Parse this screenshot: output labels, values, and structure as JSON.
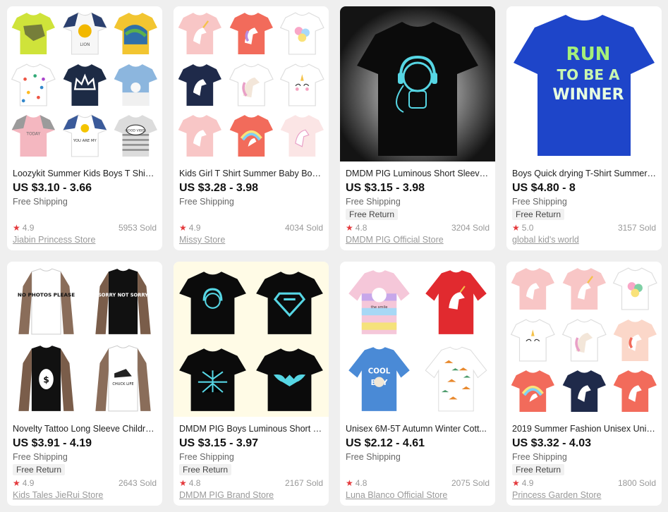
{
  "products": [
    {
      "title": "Loozykit Summer Kids Boys T Shirt...",
      "price": "US $3.10 - 3.66",
      "shipping": "Free Shipping",
      "free_return": "",
      "rating": "4.9",
      "sold": "5953 Sold",
      "store": "Jiabin Princess Store",
      "thumb_text": [
        "LION",
        "YOU ARE MY",
        "GOOD VIBES",
        "TODAY"
      ]
    },
    {
      "title": "Kids Girl T Shirt Summer Baby Boy ...",
      "price": "US $3.28 - 3.98",
      "shipping": "Free Shipping",
      "free_return": "",
      "rating": "4.9",
      "sold": "4034 Sold",
      "store": "Missy Store"
    },
    {
      "title": "DMDM PIG Luminous Short Sleeve...",
      "price": "US $3.15 - 3.98",
      "shipping": "Free Shipping",
      "free_return": "Free Return",
      "rating": "4.8",
      "sold": "3204 Sold",
      "store": "DMDM PIG Official Store"
    },
    {
      "title": "Boys Quick drying T-Shirt Summer ...",
      "price": "US $4.80 - 8",
      "shipping": "Free Shipping",
      "free_return": "Free Return",
      "rating": "5.0",
      "sold": "3157 Sold",
      "store": "global kid's world",
      "thumb_text": [
        "RUN",
        "TO BE A",
        "WINNER"
      ]
    },
    {
      "title": "Novelty Tattoo Long Sleeve Childre...",
      "price": "US $3.91 - 4.19",
      "shipping": "Free Shipping",
      "free_return": "Free Return",
      "rating": "4.9",
      "sold": "2643 Sold",
      "store": "Kids Tales JieRui Store",
      "thumb_text": [
        "NO PHOTOS PLEASE",
        "SORRY NOT SORRY",
        "$",
        "CHUCK LIFE"
      ]
    },
    {
      "title": "DMDM PIG Boys Luminous Short S...",
      "price": "US $3.15 - 3.97",
      "shipping": "Free Shipping",
      "free_return": "Free Return",
      "rating": "4.8",
      "sold": "2167 Sold",
      "store": "DMDM PIG Brand Store"
    },
    {
      "title": "Unisex 6M-5T Autumn Winter Cott...",
      "price": "US $2.12 - 4.61",
      "shipping": "Free Shipping",
      "free_return": "",
      "rating": "4.8",
      "sold": "2075 Sold",
      "store": "Luna Blanco Official Store",
      "thumb_text": [
        "the smile",
        "COOL",
        "BOY"
      ]
    },
    {
      "title": "2019 Summer Fashion Unisex Unic...",
      "price": "US $3.32 - 4.03",
      "shipping": "Free Shipping",
      "free_return": "Free Return",
      "rating": "4.9",
      "sold": "1800 Sold",
      "store": "Princess Garden Store"
    }
  ],
  "colors": {
    "star": "#e4393c",
    "page_bg": "#efefef",
    "card_bg": "#ffffff"
  }
}
